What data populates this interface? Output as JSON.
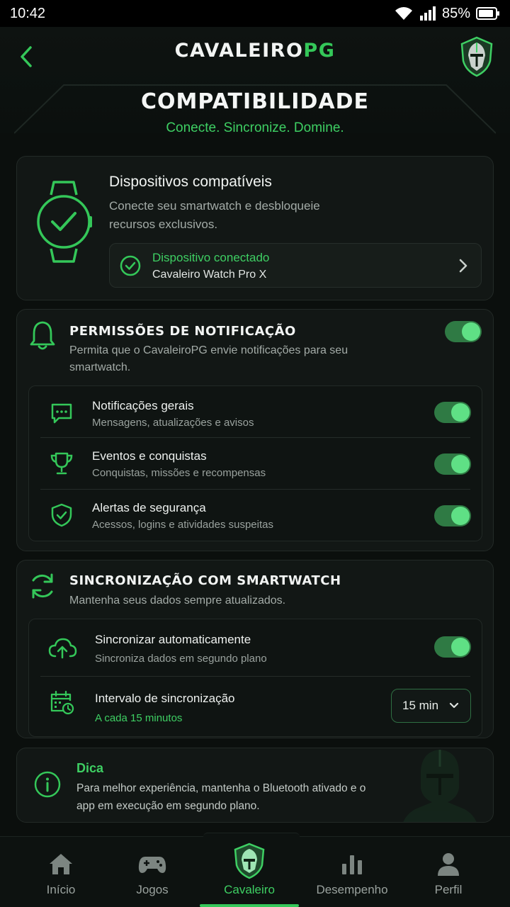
{
  "status_bar": {
    "time": "10:42",
    "battery": "85%"
  },
  "header": {
    "brand_main": "CAVALEIRO",
    "brand_accent": "PG",
    "title": "COMPATIBILIDADE",
    "subtitle": "Conecte. Sincronize. Domine."
  },
  "devices": {
    "title": "Dispositivos compatíveis",
    "description": "Conecte seu smartwatch e desbloqueie recursos exclusivos.",
    "status_label": "Dispositivo conectado",
    "device_name": "Cavaleiro Watch Pro X"
  },
  "notifications": {
    "title": "PERMISSÕES DE NOTIFICAÇÃO",
    "description": "Permita que o CavaleiroPG envie notificações para seu smartwatch.",
    "enabled": true,
    "items": [
      {
        "title": "Notificações gerais",
        "subtitle": "Mensagens, atualizações e avisos",
        "icon": "chat-icon",
        "enabled": true
      },
      {
        "title": "Eventos e conquistas",
        "subtitle": "Conquistas, missões e recompensas",
        "icon": "trophy-icon",
        "enabled": true
      },
      {
        "title": "Alertas de segurança",
        "subtitle": "Acessos, logins e atividades suspeitas",
        "icon": "shield-icon",
        "enabled": true
      }
    ]
  },
  "sync": {
    "title": "SINCRONIZAÇÃO COM SMARTWATCH",
    "description": "Mantenha seus dados sempre atualizados.",
    "auto": {
      "title": "Sincronizar automaticamente",
      "subtitle": "Sincroniza dados em segundo plano",
      "enabled": true
    },
    "interval": {
      "title": "Intervalo de sincronização",
      "subtitle": "A cada 15 minutos",
      "value": "15 min"
    }
  },
  "tip": {
    "title": "Dica",
    "text": "Para melhor experiência, mantenha o Bluetooth ativado e o app em execução em segundo plano."
  },
  "nav": {
    "items": [
      {
        "label": "Início",
        "icon": "home-icon"
      },
      {
        "label": "Jogos",
        "icon": "gamepad-icon"
      },
      {
        "label": "Cavaleiro",
        "icon": "knight-shield-icon",
        "active": true
      },
      {
        "label": "Desempenho",
        "icon": "bar-chart-icon"
      },
      {
        "label": "Perfil",
        "icon": "user-icon"
      }
    ]
  },
  "colors": {
    "accent": "#34c759",
    "background": "#0b0f0d",
    "card": "#121715"
  }
}
